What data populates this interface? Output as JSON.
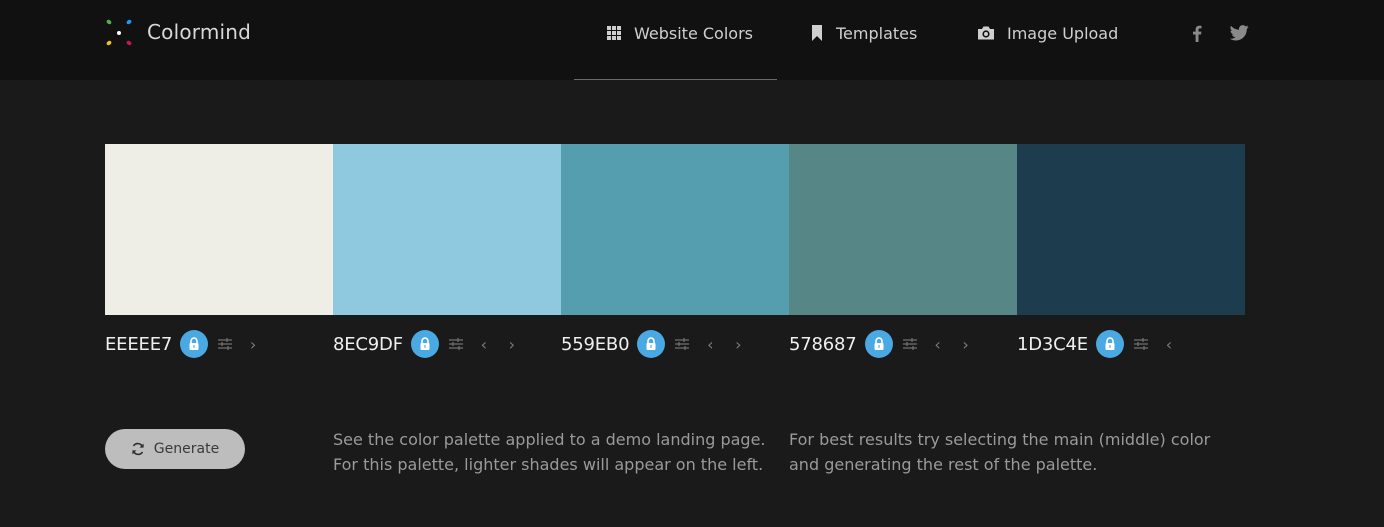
{
  "brand": {
    "name": "Colormind"
  },
  "nav": {
    "website_colors": {
      "label": "Website Colors",
      "icon": "grid-icon"
    },
    "templates": {
      "label": "Templates",
      "icon": "bookmark-icon"
    },
    "image_upload": {
      "label": "Image Upload",
      "icon": "camera-icon"
    }
  },
  "social": [
    "facebook-icon",
    "twitter-icon"
  ],
  "palette": [
    {
      "hex": "EEEEE7",
      "color": "#EEEEE7"
    },
    {
      "hex": "8EC9DF",
      "color": "#8EC9DF"
    },
    {
      "hex": "559EB0",
      "color": "#559EB0"
    },
    {
      "hex": "578687",
      "color": "#578687"
    },
    {
      "hex": "1D3C4E",
      "color": "#1D3C4E"
    }
  ],
  "generate": {
    "label": "Generate"
  },
  "info_left": {
    "line1": "See the color palette applied to a demo landing page.",
    "line2": "For this palette, lighter shades will appear on the left."
  },
  "info_right": {
    "line1": "For best results try selecting the main (middle) color",
    "line2": "and generating the rest of the palette."
  },
  "colors": {
    "accent": "#4aa8e3",
    "background": "#1a1a1a",
    "header": "#111111"
  }
}
